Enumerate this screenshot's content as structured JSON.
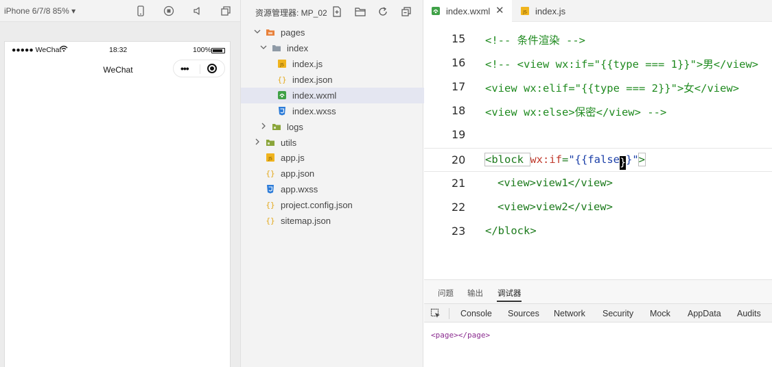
{
  "simulator": {
    "device_label": "iPhone 6/7/8 85% ▾",
    "status": {
      "carrier": "●●●●● WeChat",
      "time": "18:32",
      "battery": "100%"
    },
    "nav_title": "WeChat",
    "capsule_dots": "•••"
  },
  "explorer": {
    "title": "资源管理器: MP_02",
    "tree": [
      {
        "label": "pages",
        "kind": "folder-open"
      },
      {
        "label": "index",
        "kind": "folder-open"
      },
      {
        "label": "index.js",
        "kind": "js"
      },
      {
        "label": "index.json",
        "kind": "json"
      },
      {
        "label": "index.wxml",
        "kind": "wxml",
        "selected": true
      },
      {
        "label": "index.wxss",
        "kind": "wxss"
      },
      {
        "label": "logs",
        "kind": "folder"
      },
      {
        "label": "utils",
        "kind": "folder"
      },
      {
        "label": "app.js",
        "kind": "js"
      },
      {
        "label": "app.json",
        "kind": "json"
      },
      {
        "label": "app.wxss",
        "kind": "wxss"
      },
      {
        "label": "project.config.json",
        "kind": "json"
      },
      {
        "label": "sitemap.json",
        "kind": "json"
      }
    ]
  },
  "editor": {
    "tabs": [
      {
        "label": "index.wxml",
        "close": "✕"
      },
      {
        "label": "index.js"
      }
    ],
    "line_numbers": [
      "15",
      "16",
      "17",
      "18",
      "19",
      "20",
      "21",
      "22",
      "23"
    ],
    "lines": {
      "l15": "<!-- 条件渲染 -->",
      "l16": "<!-- <view wx:if=\"{{type === 1}}\">男</view>",
      "l17": "<view wx:elif=\"{{type === 2}}\">女</view>",
      "l18": "<view wx:else>保密</view> -->",
      "l20_open": "<block ",
      "l20_attr": "wx:if",
      "l20_eq": "=",
      "l20_val": "\"{{false",
      "l20_cursor_char": "}",
      "l20_val_end": "}\"",
      "l20_close": ">",
      "l21": "<view>view1</view>",
      "l22": "<view>view2</view>",
      "l23": "</block>"
    }
  },
  "panel": {
    "tabs": [
      "问题",
      "输出",
      "调试器"
    ],
    "devtools_tabs": [
      "Console",
      "Sources",
      "Network",
      "Security",
      "Mock",
      "AppData",
      "Audits"
    ],
    "console_output": "<page></page>"
  },
  "colors": {
    "comment": "#1f8a1f",
    "tag": "#1b7a1b",
    "attr": "#c0392b",
    "value": "#1b3fa8",
    "selected_row": "#e4e6f1",
    "folder": "#e8813b",
    "js": "#f0b41e",
    "json": "#f0b41e",
    "wxml": "#3fa147",
    "wxss": "#2b7bd8"
  }
}
